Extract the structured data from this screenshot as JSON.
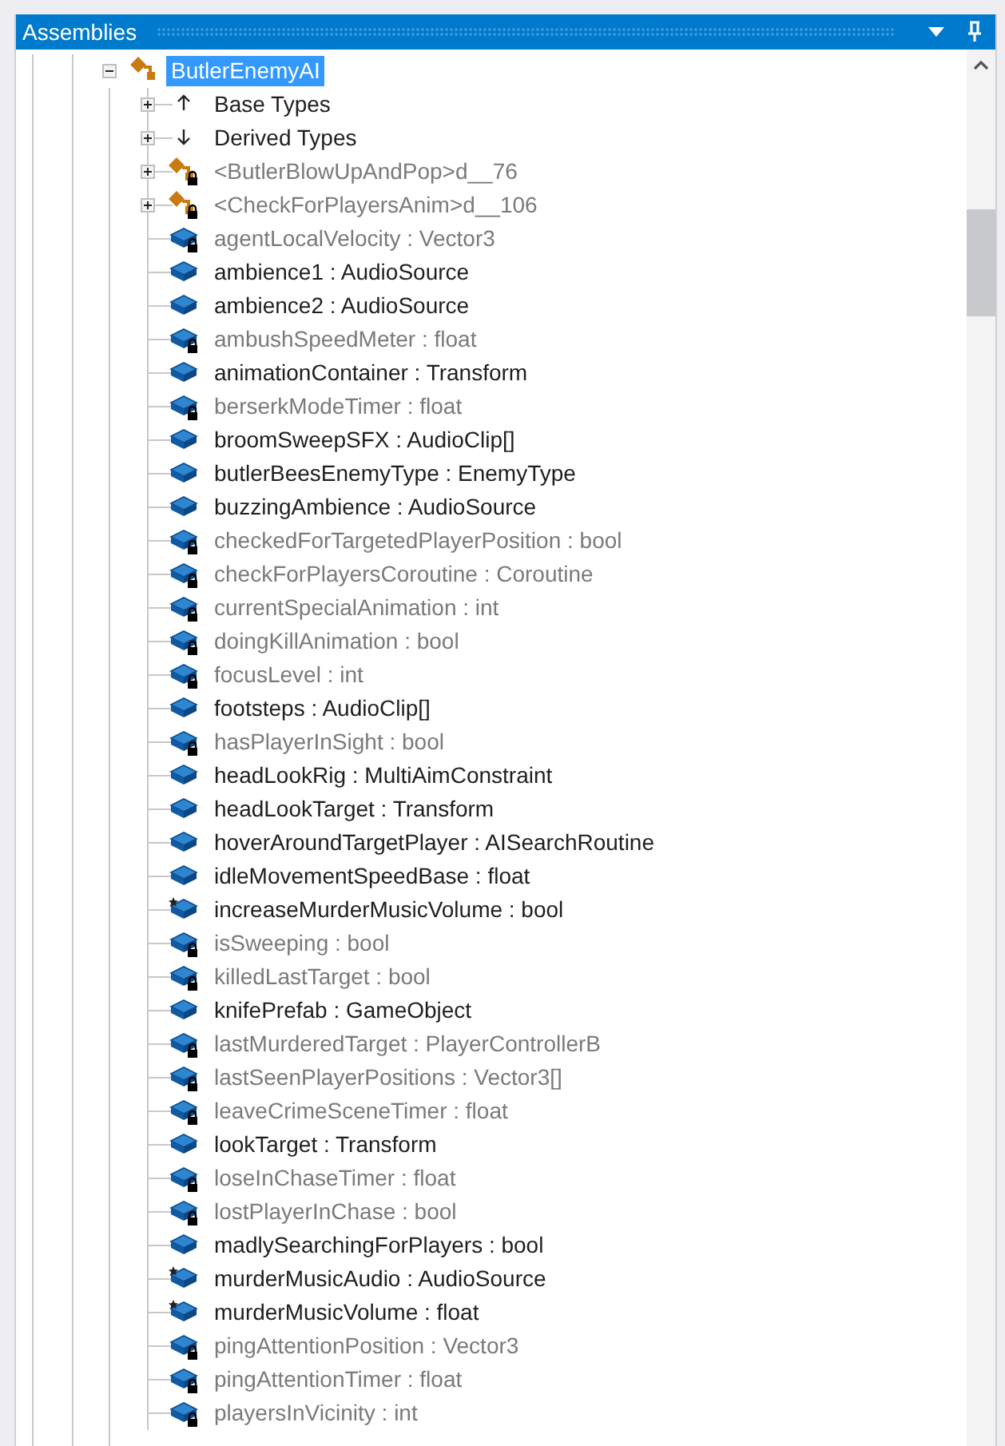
{
  "panel": {
    "title": "Assemblies"
  },
  "tree": {
    "label": "ButlerEnemyAI",
    "kind": "class",
    "selected": true,
    "expanded": true,
    "children": [
      {
        "label": "Base Types",
        "kind": "base-types",
        "expanded": false
      },
      {
        "label": "Derived Types",
        "kind": "derived-types",
        "expanded": false
      },
      {
        "label": "<ButlerBlowUpAndPop>d__76",
        "kind": "nested-class",
        "locked": true,
        "starred": false,
        "expanded": false
      },
      {
        "label": "<CheckForPlayersAnim>d__106",
        "kind": "nested-class",
        "locked": true,
        "starred": false,
        "expanded": false
      },
      {
        "label": "agentLocalVelocity : Vector3",
        "kind": "field",
        "locked": true,
        "starred": false
      },
      {
        "label": "ambience1 : AudioSource",
        "kind": "field",
        "locked": false,
        "starred": false
      },
      {
        "label": "ambience2 : AudioSource",
        "kind": "field",
        "locked": false,
        "starred": false
      },
      {
        "label": "ambushSpeedMeter : float",
        "kind": "field",
        "locked": true,
        "starred": false
      },
      {
        "label": "animationContainer : Transform",
        "kind": "field",
        "locked": false,
        "starred": false
      },
      {
        "label": "berserkModeTimer : float",
        "kind": "field",
        "locked": true,
        "starred": false
      },
      {
        "label": "broomSweepSFX : AudioClip[]",
        "kind": "field",
        "locked": false,
        "starred": false
      },
      {
        "label": "butlerBeesEnemyType : EnemyType",
        "kind": "field",
        "locked": false,
        "starred": false
      },
      {
        "label": "buzzingAmbience : AudioSource",
        "kind": "field",
        "locked": false,
        "starred": false
      },
      {
        "label": "checkedForTargetedPlayerPosition : bool",
        "kind": "field",
        "locked": true,
        "starred": false
      },
      {
        "label": "checkForPlayersCoroutine : Coroutine",
        "kind": "field",
        "locked": true,
        "starred": false
      },
      {
        "label": "currentSpecialAnimation : int",
        "kind": "field",
        "locked": true,
        "starred": false
      },
      {
        "label": "doingKillAnimation : bool",
        "kind": "field",
        "locked": true,
        "starred": false
      },
      {
        "label": "focusLevel : int",
        "kind": "field",
        "locked": true,
        "starred": false
      },
      {
        "label": "footsteps : AudioClip[]",
        "kind": "field",
        "locked": false,
        "starred": false
      },
      {
        "label": "hasPlayerInSight : bool",
        "kind": "field",
        "locked": true,
        "starred": false
      },
      {
        "label": "headLookRig : MultiAimConstraint",
        "kind": "field",
        "locked": false,
        "starred": false
      },
      {
        "label": "headLookTarget : Transform",
        "kind": "field",
        "locked": false,
        "starred": false
      },
      {
        "label": "hoverAroundTargetPlayer : AISearchRoutine",
        "kind": "field",
        "locked": false,
        "starred": false
      },
      {
        "label": "idleMovementSpeedBase : float",
        "kind": "field",
        "locked": false,
        "starred": false
      },
      {
        "label": "increaseMurderMusicVolume : bool",
        "kind": "field",
        "locked": false,
        "starred": true
      },
      {
        "label": "isSweeping : bool",
        "kind": "field",
        "locked": true,
        "starred": false
      },
      {
        "label": "killedLastTarget : bool",
        "kind": "field",
        "locked": true,
        "starred": false
      },
      {
        "label": "knifePrefab : GameObject",
        "kind": "field",
        "locked": false,
        "starred": false
      },
      {
        "label": "lastMurderedTarget : PlayerControllerB",
        "kind": "field",
        "locked": true,
        "starred": false
      },
      {
        "label": "lastSeenPlayerPositions : Vector3[]",
        "kind": "field",
        "locked": true,
        "starred": false
      },
      {
        "label": "leaveCrimeSceneTimer : float",
        "kind": "field",
        "locked": true,
        "starred": false
      },
      {
        "label": "lookTarget : Transform",
        "kind": "field",
        "locked": false,
        "starred": false
      },
      {
        "label": "loseInChaseTimer : float",
        "kind": "field",
        "locked": true,
        "starred": false
      },
      {
        "label": "lostPlayerInChase : bool",
        "kind": "field",
        "locked": true,
        "starred": false
      },
      {
        "label": "madlySearchingForPlayers : bool",
        "kind": "field",
        "locked": false,
        "starred": false
      },
      {
        "label": "murderMusicAudio : AudioSource",
        "kind": "field",
        "locked": false,
        "starred": true
      },
      {
        "label": "murderMusicVolume : float",
        "kind": "field",
        "locked": false,
        "starred": true
      },
      {
        "label": "pingAttentionPosition : Vector3",
        "kind": "field",
        "locked": true,
        "starred": false
      },
      {
        "label": "pingAttentionTimer : float",
        "kind": "field",
        "locked": true,
        "starred": false
      },
      {
        "label": "playersInVicinity : int",
        "kind": "field",
        "locked": true,
        "starred": false
      }
    ]
  }
}
